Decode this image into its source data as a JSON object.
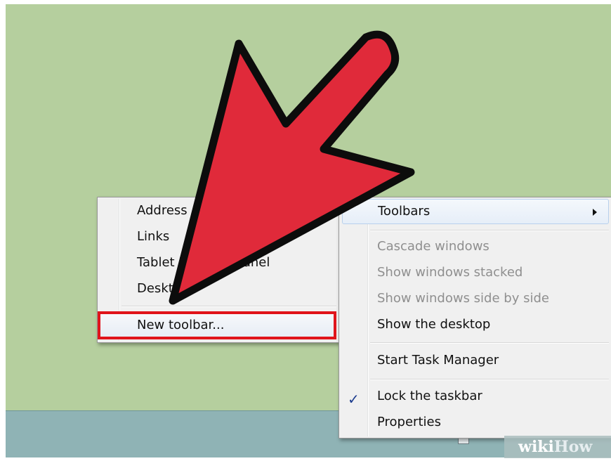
{
  "submenu": {
    "items": [
      "Address",
      "Links",
      "Tablet PC Input Panel",
      "Desktop",
      "New toolbar..."
    ]
  },
  "context_menu": {
    "toolbars_label": "Toolbars",
    "items": [
      {
        "label": "Cascade windows",
        "enabled": false
      },
      {
        "label": "Show windows stacked",
        "enabled": false
      },
      {
        "label": "Show windows side by side",
        "enabled": false
      },
      {
        "label": "Show the desktop",
        "enabled": true
      },
      {
        "label": "Start Task Manager",
        "enabled": true
      },
      {
        "label": "Lock the taskbar",
        "enabled": true,
        "checked": true
      },
      {
        "label": "Properties",
        "enabled": true
      }
    ],
    "check_mark": "✓"
  },
  "watermark": {
    "part1": "wiki",
    "part2": "How"
  },
  "colors": {
    "desktop": "#b5cf9e",
    "taskbar": "#8fb3b5",
    "arrow": "#e02a3a",
    "highlight_border": "#e0141b"
  }
}
